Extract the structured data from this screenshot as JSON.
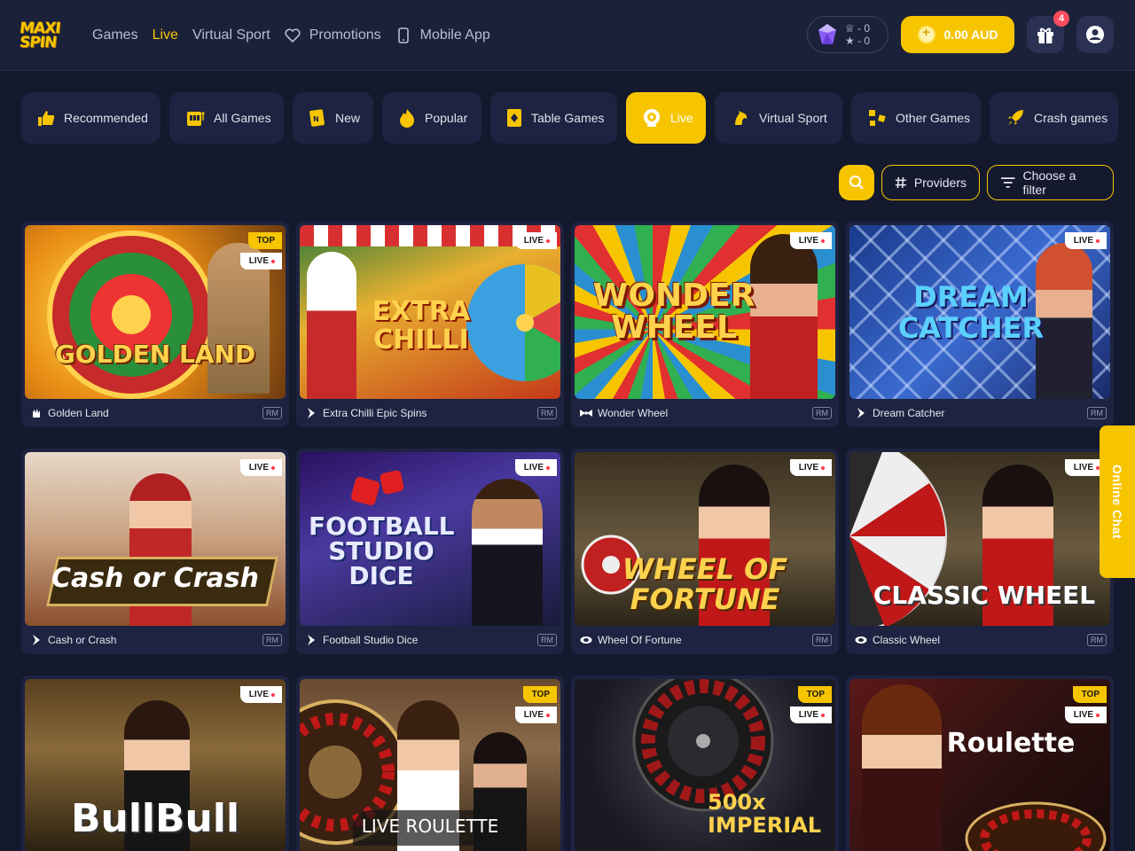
{
  "brand": {
    "logo_line1": "MAXI",
    "logo_line2": "SPIN"
  },
  "nav": [
    {
      "label": "Games"
    },
    {
      "label": "Live",
      "active": true
    },
    {
      "label": "Virtual Sport"
    },
    {
      "label": "Promotions",
      "icon": "heart-icon"
    },
    {
      "label": "Mobile App",
      "icon": "phone-icon"
    }
  ],
  "header": {
    "level_stat_1": "- 0",
    "level_stat_2": "- 0",
    "balance": "0.00 AUD",
    "gift_badge": "4"
  },
  "categories": [
    {
      "label": "Recommended",
      "icon": "thumbs-up-icon"
    },
    {
      "label": "All Games",
      "icon": "slot-machine-icon"
    },
    {
      "label": "New",
      "icon": "new-card-icon"
    },
    {
      "label": "Popular",
      "icon": "flame-icon"
    },
    {
      "label": "Table Games",
      "icon": "card-icon"
    },
    {
      "label": "Live",
      "icon": "live-dealer-icon",
      "active": true
    },
    {
      "label": "Virtual Sport",
      "icon": "horse-icon"
    },
    {
      "label": "Other Games",
      "icon": "puzzle-icon"
    },
    {
      "label": "Crash games",
      "icon": "rocket-icon"
    }
  ],
  "filters": {
    "providers_label": "Providers",
    "choose_filter_label": "Choose a filter"
  },
  "tags": {
    "live": "LIVE",
    "top": "TOP"
  },
  "rm_label": "RM",
  "games": [
    {
      "name": "Golden Land",
      "art": "GOLDEN LAND",
      "top": true,
      "live": true
    },
    {
      "name": "Extra Chilli Epic Spins",
      "art": "EXTRA CHILLI",
      "top": false,
      "live": true
    },
    {
      "name": "Wonder Wheel",
      "art": "WONDER WHEEL",
      "top": false,
      "live": true
    },
    {
      "name": "Dream Catcher",
      "art": "DREAM CATCHER",
      "top": false,
      "live": true
    },
    {
      "name": "Cash or Crash",
      "art": "Cash or Crash",
      "top": false,
      "live": true
    },
    {
      "name": "Football Studio Dice",
      "art": "FOOTBALL STUDIO DICE",
      "top": false,
      "live": true
    },
    {
      "name": "Wheel Of Fortune",
      "art": "WHEEL OF FORTUNE",
      "top": false,
      "live": true
    },
    {
      "name": "Classic Wheel",
      "art": "CLASSIC WHEEL",
      "top": false,
      "live": true
    },
    {
      "name": "",
      "art": "BullBull",
      "top": false,
      "live": true
    },
    {
      "name": "",
      "art": "LIVE ROULETTE",
      "top": true,
      "live": true
    },
    {
      "name": "",
      "art": "500x IMPERIAL",
      "top": true,
      "live": true
    },
    {
      "name": "",
      "art": "Roulette",
      "top": true,
      "live": true
    }
  ],
  "chat": {
    "label": "Online Chat"
  },
  "colors": {
    "accent": "#f7c500",
    "background": "#14192e",
    "card": "#1d2340",
    "live_dot": "#ff3b4a"
  }
}
